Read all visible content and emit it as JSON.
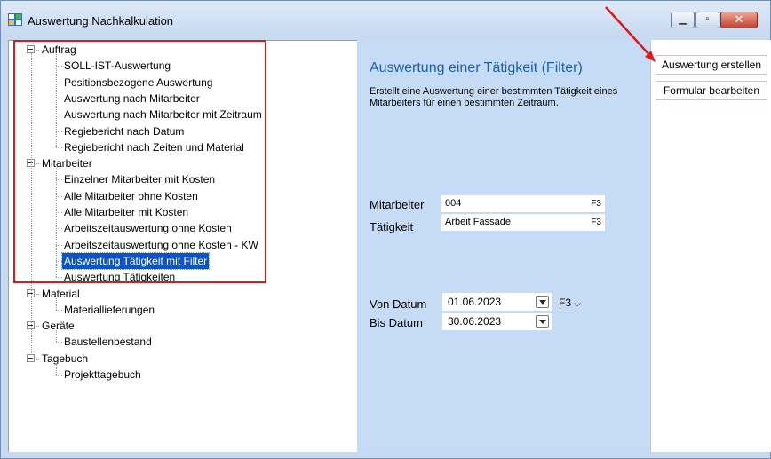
{
  "window": {
    "title": "Auswertung Nachkalkulation"
  },
  "tree": {
    "rows": [
      {
        "label": "Auftrag",
        "level": 0
      },
      {
        "label": "SOLL-IST-Auswertung",
        "level": 1
      },
      {
        "label": "Positionsbezogene Auswertung",
        "level": 1
      },
      {
        "label": "Auswertung nach Mitarbeiter",
        "level": 1
      },
      {
        "label": "Auswertung nach Mitarbeiter mit Zeitraum",
        "level": 1
      },
      {
        "label": "Regiebericht nach Datum",
        "level": 1
      },
      {
        "label": "Regiebericht nach Zeiten und Material",
        "level": 1
      },
      {
        "label": "Mitarbeiter",
        "level": 0
      },
      {
        "label": "Einzelner Mitarbeiter mit Kosten",
        "level": 1
      },
      {
        "label": "Alle Mitarbeiter ohne Kosten",
        "level": 1
      },
      {
        "label": "Alle Mitarbeiter mit Kosten",
        "level": 1
      },
      {
        "label": "Arbeitszeitauswertung ohne Kosten",
        "level": 1
      },
      {
        "label": "Arbeitszeitauswertung ohne Kosten - KW",
        "level": 1
      },
      {
        "label": "Auswertung Tätigkeit mit Filter",
        "level": 1,
        "selected": true
      },
      {
        "label": "Auswertung Tätigkeiten",
        "level": 1
      },
      {
        "label": "Material",
        "level": 0
      },
      {
        "label": "Materiallieferungen",
        "level": 1
      },
      {
        "label": "Geräte",
        "level": 0
      },
      {
        "label": "Baustellenbestand",
        "level": 1
      },
      {
        "label": "Tagebuch",
        "level": 0
      },
      {
        "label": "Projekttagebuch",
        "level": 1
      }
    ]
  },
  "panel": {
    "heading": "Auswertung einer Tätigkeit (Filter)",
    "description": "Erstellt eine Auswertung einer bestimmten Tätigkeit eines Mitarbeiters für einen bestimmten Zeitraum.",
    "mitarbeiter_label": "Mitarbeiter",
    "mitarbeiter_value": "004",
    "taetigkeit_label": "Tätigkeit",
    "taetigkeit_value": "Arbeit Fassade",
    "f3": "F3",
    "von_label": "Von Datum",
    "von_value": "01.06.2023",
    "bis_label": "Bis Datum",
    "bis_value": "30.06.2023",
    "date_f3": "F3"
  },
  "buttons": {
    "create": "Auswertung erstellen",
    "edit_form": "Formular bearbeiten"
  },
  "colors": {
    "highlight_box": "#e01818",
    "selection": "#0a53c8",
    "heading": "#1b5fb0"
  }
}
